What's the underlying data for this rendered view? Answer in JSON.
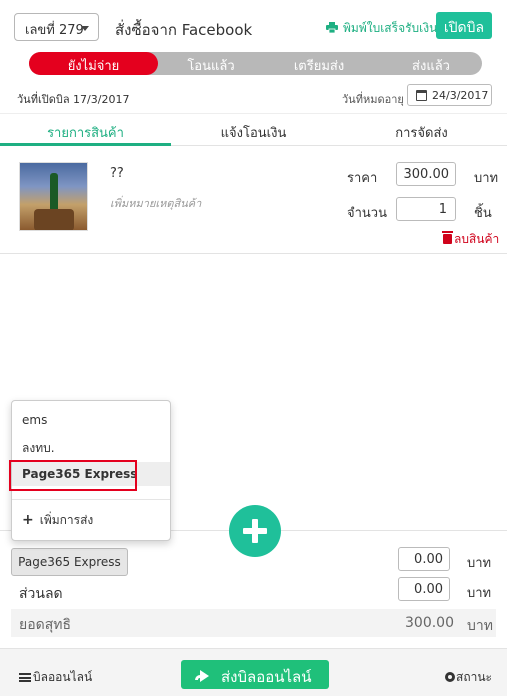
{
  "header": {
    "order_number": "เลขที่ 279",
    "title": "สั่งซื้อจาก Facebook",
    "print_receipt": "พิมพ์ใบเสร็จรับเงิน",
    "open_bill": "เปิดบิล"
  },
  "status_steps": [
    {
      "label": "ยังไม่จ่าย",
      "active": true
    },
    {
      "label": "โอนแล้ว",
      "active": false
    },
    {
      "label": "เตรียมส่ง",
      "active": false
    },
    {
      "label": "ส่งแล้ว",
      "active": false
    }
  ],
  "dates": {
    "opened": "วันที่เปิดบิล 17/3/2017",
    "expire_label": "วันที่หมดอายุ",
    "expire_value": "24/3/2017"
  },
  "tabs": [
    {
      "label": "รายการสินค้า",
      "active": true
    },
    {
      "label": "แจ้งโอนเงิน",
      "active": false
    },
    {
      "label": "การจัดส่ง",
      "active": false
    }
  ],
  "item": {
    "name": "??",
    "note_placeholder": "เพิ่มหมายเหตุสินค้า",
    "price_label": "ราคา",
    "price": "300.00",
    "price_unit": "บาท",
    "qty_label": "จำนวน",
    "qty": "1",
    "qty_unit": "ชิ้น",
    "delete_label": "ลบสินค้า"
  },
  "shipping_dropdown": {
    "options": [
      "ems",
      "ลงทบ.",
      "Page365 Express"
    ],
    "selected": "Page365 Express",
    "add_label": "เพิ่มการส่ง"
  },
  "shipping": {
    "method": "Page365 Express",
    "cost": "0.00",
    "unit": "บาท"
  },
  "discount": {
    "label": "ส่วนลด",
    "value": "0.00",
    "unit": "บาท"
  },
  "net": {
    "label": "ยอดสุทธิ",
    "value": "300.00",
    "unit": "บาท"
  },
  "bottom": {
    "bill_online": "บิลออนไลน์",
    "send_bill": "ส่งบิลออนไลน์",
    "status": "สถานะ"
  },
  "colors": {
    "accent": "#1fc09a",
    "danger": "#e4001e",
    "send_button": "#1fc07a"
  }
}
